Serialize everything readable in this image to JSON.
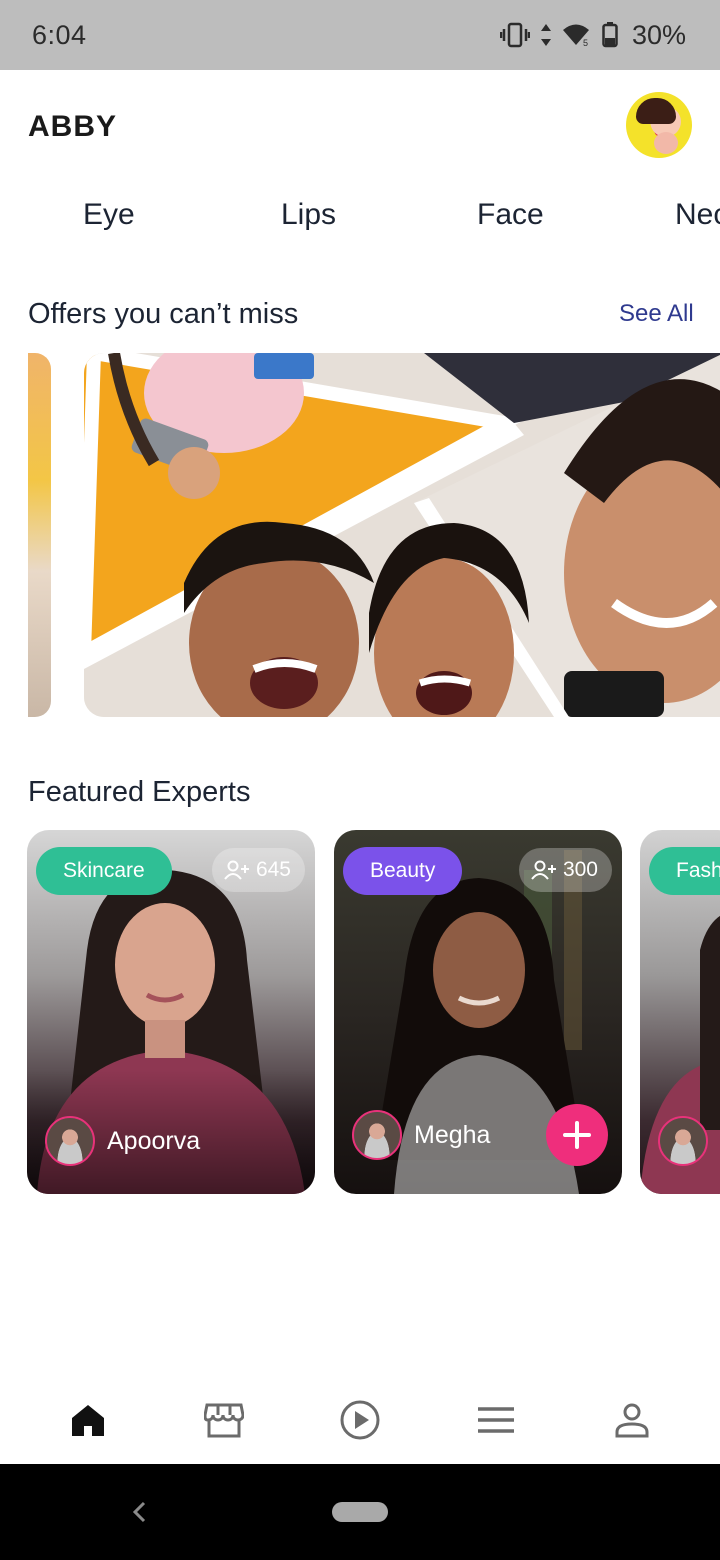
{
  "status_bar": {
    "time": "6:04",
    "battery": "30%"
  },
  "header": {
    "brand": "ABBY"
  },
  "categories": [
    "Eye",
    "Lips",
    "Face",
    "Neck"
  ],
  "offers": {
    "title": "Offers you can’t miss",
    "see_all": "See All"
  },
  "featured": {
    "title": "Featured Experts",
    "experts": [
      {
        "tag": "Skincare",
        "tag_color": "#2fbf95",
        "followers": "645",
        "name": "Apoorva"
      },
      {
        "tag": "Beauty",
        "tag_color": "#7b52ea",
        "followers": "300",
        "name": "Megha"
      },
      {
        "tag": "Fashion",
        "tag_color": "#2fbf95"
      }
    ]
  },
  "colors": {
    "accent_pink": "#ef2e7c",
    "title": "#1c2433",
    "link": "#2f3a8f"
  },
  "bottom_nav": [
    "home-icon",
    "store-icon",
    "play-icon",
    "menu-icon",
    "profile-icon"
  ]
}
